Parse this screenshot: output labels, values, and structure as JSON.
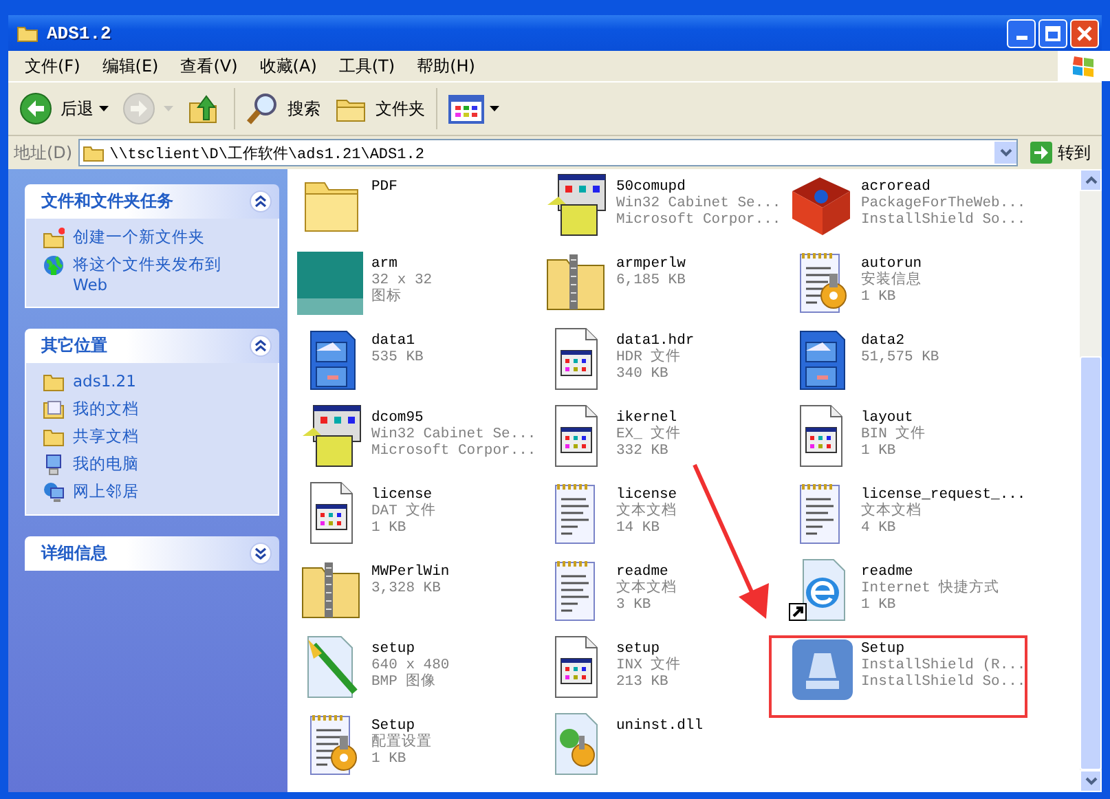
{
  "window": {
    "title": "ADS1.2"
  },
  "menu": [
    {
      "label": "文件(F)"
    },
    {
      "label": "编辑(E)"
    },
    {
      "label": "查看(V)"
    },
    {
      "label": "收藏(A)"
    },
    {
      "label": "工具(T)"
    },
    {
      "label": "帮助(H)"
    }
  ],
  "toolbar": [
    {
      "kind": "back",
      "label": "后退",
      "dropdown": true,
      "disabled": false
    },
    {
      "kind": "forward",
      "dropdown": true,
      "disabled": true
    },
    {
      "kind": "up",
      "dropdown": false,
      "disabled": false
    },
    {
      "kind": "search",
      "label": "搜索",
      "dropdown": false,
      "disabled": false
    },
    {
      "kind": "folders",
      "label": "文件夹",
      "dropdown": false,
      "disabled": false
    },
    {
      "kind": "views",
      "dropdown": true,
      "disabled": false
    }
  ],
  "address": {
    "label": "地址(D)",
    "value": "\\\\tsclient\\D\\工作软件\\ads1.21\\ADS1.2",
    "go": "转到"
  },
  "sidebar": [
    {
      "title": "文件和文件夹任务",
      "expanded": true,
      "items": [
        {
          "kind": "newfolder",
          "label": "创建一个新文件夹"
        },
        {
          "kind": "publish",
          "label": "将这个文件夹发布到 Web"
        }
      ]
    },
    {
      "title": "其它位置",
      "expanded": true,
      "items": [
        {
          "kind": "folder",
          "label": "ads1.21"
        },
        {
          "kind": "docs",
          "label": "我的文档"
        },
        {
          "kind": "folder",
          "label": "共享文档"
        },
        {
          "kind": "computer",
          "label": "我的电脑"
        },
        {
          "kind": "network",
          "label": "网上邻居"
        }
      ]
    },
    {
      "title": "详细信息",
      "expanded": false
    }
  ],
  "files": [
    {
      "kind": "folder",
      "name": "PDF",
      "highlighted": false
    },
    {
      "kind": "cab",
      "name": "50comupd",
      "details": [
        "Win32 Cabinet Se...",
        "Microsoft Corpor..."
      ],
      "highlighted": false
    },
    {
      "kind": "box",
      "name": "acroread",
      "details": [
        "PackageForTheWeb...",
        "InstallShield So..."
      ],
      "highlighted": false
    },
    {
      "kind": "arm",
      "name": "arm",
      "details": [
        "32 x 32",
        "图标"
      ],
      "highlighted": false
    },
    {
      "kind": "zip",
      "name": "armperlw",
      "details": [
        "6,185 KB"
      ],
      "highlighted": false
    },
    {
      "kind": "inf",
      "name": "autorun",
      "details": [
        "安装信息",
        "1 KB"
      ],
      "highlighted": false
    },
    {
      "kind": "cabinet",
      "name": "data1",
      "details": [
        "535 KB"
      ],
      "highlighted": false
    },
    {
      "kind": "generic",
      "name": "data1.hdr",
      "details": [
        "HDR 文件",
        "340 KB"
      ],
      "highlighted": false
    },
    {
      "kind": "cabinet",
      "name": "data2",
      "details": [
        "51,575 KB"
      ],
      "highlighted": false
    },
    {
      "kind": "cab",
      "name": "dcom95",
      "details": [
        "Win32 Cabinet Se...",
        "Microsoft Corpor..."
      ],
      "highlighted": false
    },
    {
      "kind": "generic",
      "name": "ikernel",
      "details": [
        "EX_ 文件",
        "332 KB"
      ],
      "highlighted": false
    },
    {
      "kind": "generic",
      "name": "layout",
      "details": [
        "BIN 文件",
        "1 KB"
      ],
      "highlighted": false
    },
    {
      "kind": "generic",
      "name": "license",
      "details": [
        "DAT 文件",
        "1 KB"
      ],
      "highlighted": false
    },
    {
      "kind": "text",
      "name": "license",
      "details": [
        "文本文档",
        "14 KB"
      ],
      "highlighted": false
    },
    {
      "kind": "text",
      "name": "license_request_...",
      "details": [
        "文本文档",
        "4 KB"
      ],
      "highlighted": false
    },
    {
      "kind": "zip",
      "name": "MWPerlWin",
      "details": [
        "3,328 KB"
      ],
      "highlighted": false
    },
    {
      "kind": "text",
      "name": "readme",
      "details": [
        "文本文档",
        "3 KB"
      ],
      "highlighted": false
    },
    {
      "kind": "shortcut",
      "name": "readme",
      "details": [
        "Internet 快捷方式",
        "1 KB"
      ],
      "highlighted": false
    },
    {
      "kind": "bmp",
      "name": "setup",
      "details": [
        "640 x 480",
        "BMP 图像"
      ],
      "highlighted": false
    },
    {
      "kind": "generic",
      "name": "setup",
      "details": [
        "INX 文件",
        "213 KB"
      ],
      "highlighted": false
    },
    {
      "kind": "installer",
      "name": "Setup",
      "details": [
        "InstallShield (R...",
        "InstallShield So..."
      ],
      "highlighted": true
    },
    {
      "kind": "inf",
      "name": "Setup",
      "details": [
        "配置设置",
        "1 KB"
      ],
      "highlighted": false
    },
    {
      "kind": "dll",
      "name": "uninst.dll",
      "highlighted": false
    }
  ],
  "annotations": {
    "arrow": true
  }
}
